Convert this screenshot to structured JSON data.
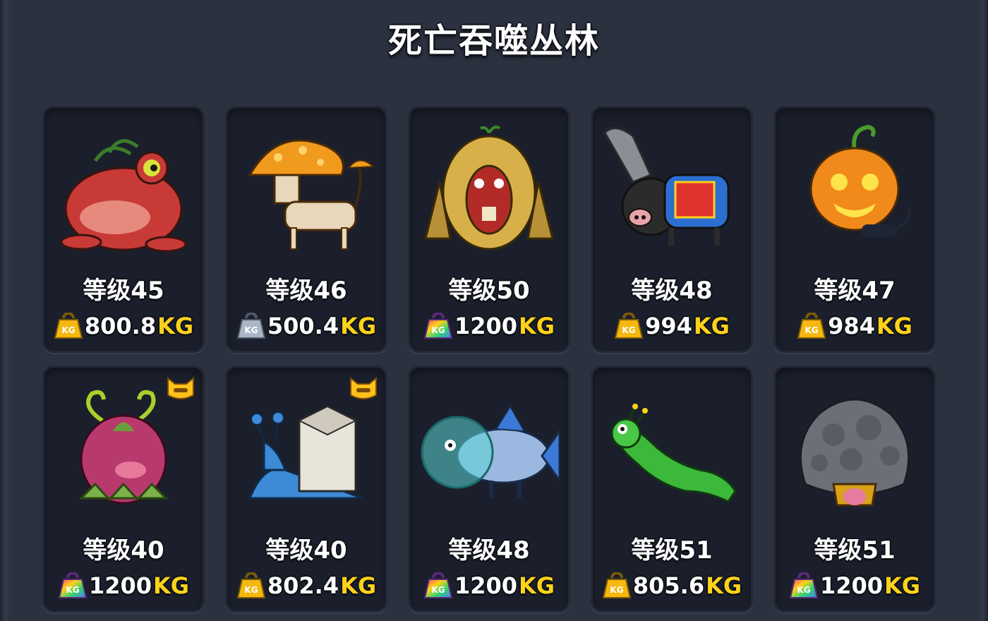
{
  "title": "死亡吞噬丛林",
  "weight_unit": "KG",
  "kg_icon_text": "KG",
  "colors": {
    "gold_weight": "#f6b80e",
    "silver_weight": "#a8b6c6",
    "rainbow_weight": "rainbow",
    "unit_yellow": "#ffd21a"
  },
  "cards": [
    {
      "name": "red-toad-monster",
      "level": "等级45",
      "weight": "800.8",
      "weight_icon": "gold",
      "badge": false
    },
    {
      "name": "mushroom-dog-monster",
      "level": "等级46",
      "weight": "500.4",
      "weight_icon": "silver",
      "badge": false
    },
    {
      "name": "sprout-ape-monster",
      "level": "等级50",
      "weight": "1200",
      "weight_icon": "rainbow",
      "badge": false
    },
    {
      "name": "chainsaw-pig-monster",
      "level": "等级48",
      "weight": "994",
      "weight_icon": "gold",
      "badge": false
    },
    {
      "name": "pumpkin-cat-monster",
      "level": "等级47",
      "weight": "984",
      "weight_icon": "gold",
      "badge": false
    },
    {
      "name": "onion-monster",
      "level": "等级40",
      "weight": "1200",
      "weight_icon": "rainbow",
      "badge": true
    },
    {
      "name": "milk-snail-monster",
      "level": "等级40",
      "weight": "802.4",
      "weight_icon": "gold",
      "badge": true
    },
    {
      "name": "fishbowl-fish-monster",
      "level": "等级48",
      "weight": "1200",
      "weight_icon": "rainbow",
      "badge": false
    },
    {
      "name": "green-caterpillar-monster",
      "level": "等级51",
      "weight": "805.6",
      "weight_icon": "gold",
      "badge": false
    },
    {
      "name": "rock-golem-monster",
      "level": "等级51",
      "weight": "1200",
      "weight_icon": "rainbow",
      "badge": false
    }
  ]
}
